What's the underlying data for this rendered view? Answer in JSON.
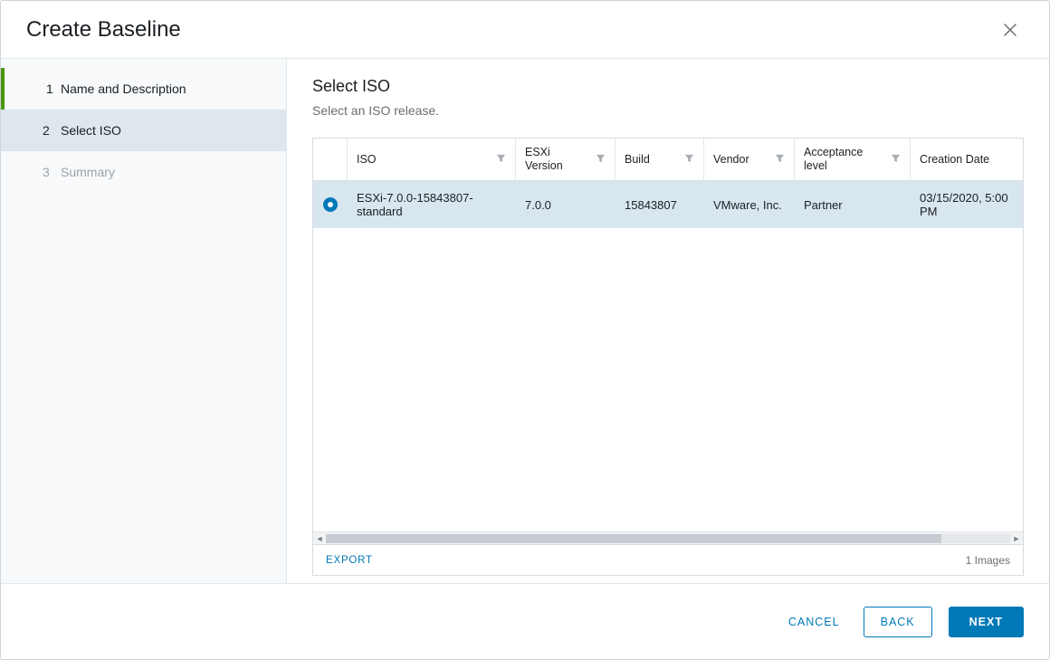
{
  "modal": {
    "title": "Create Baseline"
  },
  "sidebar": {
    "steps": [
      {
        "num": "1",
        "label": "Name and Description",
        "state": "done"
      },
      {
        "num": "2",
        "label": "Select ISO",
        "state": "active"
      },
      {
        "num": "3",
        "label": "Summary",
        "state": "future"
      }
    ]
  },
  "main": {
    "title": "Select ISO",
    "subtitle": "Select an ISO release."
  },
  "table": {
    "columns": {
      "iso": "ISO",
      "version": "ESXi Version",
      "build": "Build",
      "vendor": "Vendor",
      "acceptance": "Acceptance level",
      "date": "Creation Date"
    },
    "rows": [
      {
        "selected": true,
        "iso": "ESXi-7.0.0-15843807-standard",
        "version": "7.0.0",
        "build": "15843807",
        "vendor": "VMware, Inc.",
        "acceptance": "Partner",
        "date": "03/15/2020, 5:00 PM"
      }
    ],
    "export_label": "EXPORT",
    "count_label": "1 Images"
  },
  "footer": {
    "cancel": "CANCEL",
    "back": "BACK",
    "next": "NEXT"
  }
}
